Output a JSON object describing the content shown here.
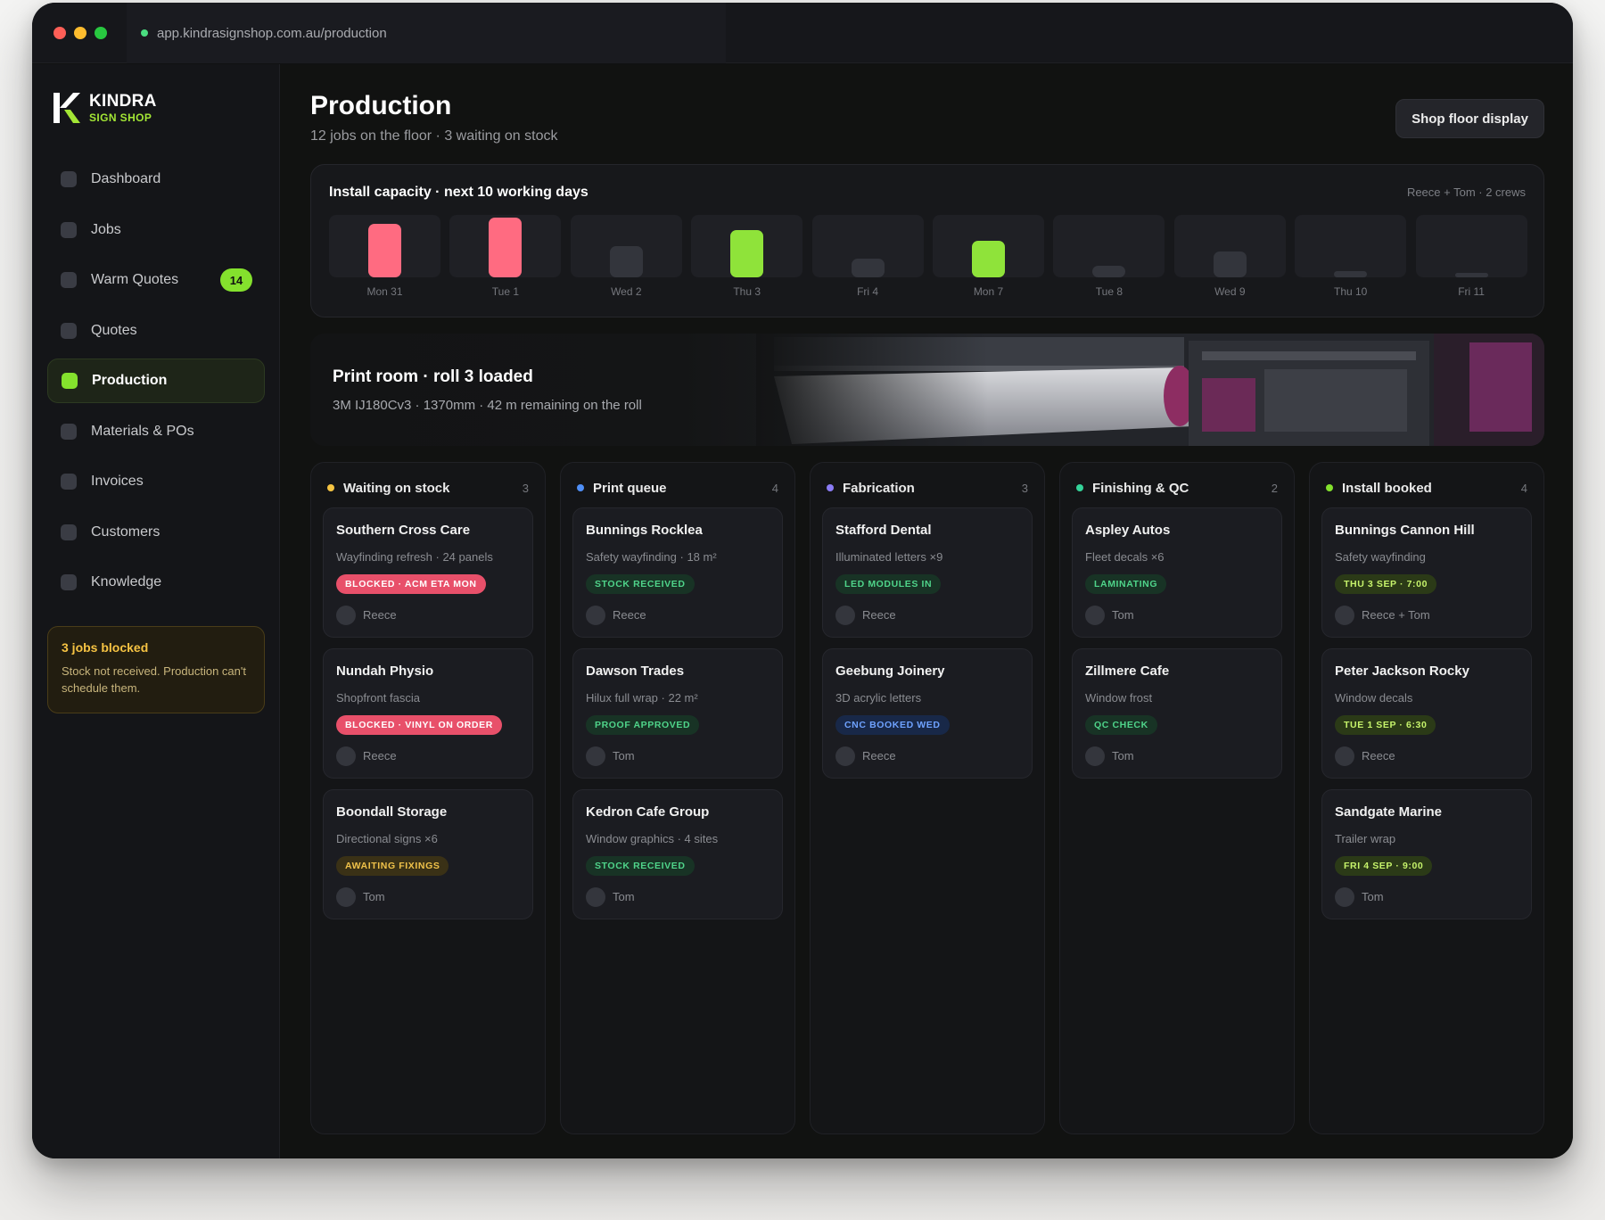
{
  "browser": {
    "url": "app.kindrasignshop.com.au/production",
    "colors": {
      "close": "#ff5f57",
      "minimize": "#febc2e",
      "maximize": "#28c840"
    }
  },
  "brand": {
    "name": "KINDRA",
    "tagline": "SIGN SHOP",
    "accent": "#84e12d"
  },
  "sidebar": {
    "items": [
      {
        "label": "Dashboard",
        "icon": "dashboard-icon"
      },
      {
        "label": "Jobs",
        "icon": "jobs-icon"
      },
      {
        "label": "Warm Quotes",
        "icon": "warm-quotes-icon",
        "badge": "14"
      },
      {
        "label": "Quotes",
        "icon": "quotes-icon"
      },
      {
        "label": "Production",
        "icon": "production-icon",
        "active": true
      },
      {
        "label": "Materials & POs",
        "icon": "materials-icon"
      },
      {
        "label": "Invoices",
        "icon": "invoices-icon"
      },
      {
        "label": "Customers",
        "icon": "customers-icon"
      },
      {
        "label": "Knowledge",
        "icon": "knowledge-icon"
      }
    ],
    "alert": {
      "title": "3 jobs blocked",
      "body": "Stock not received. Production can't schedule them."
    }
  },
  "header": {
    "title": "Production",
    "subtitle": "12 jobs on the floor · 3 waiting on stock",
    "button": "Shop floor display"
  },
  "capacity": {
    "title": "Install capacity · next 10 working days",
    "meta": "Reece + Tom · 2 crews",
    "days": [
      {
        "label": "Mon 31",
        "load": 0.86,
        "status": "over"
      },
      {
        "label": "Tue 1",
        "load": 0.96,
        "status": "over"
      },
      {
        "label": "Wed 2",
        "load": 0.5,
        "status": "free"
      },
      {
        "label": "Thu 3",
        "load": 0.76,
        "status": "booked"
      },
      {
        "label": "Fri 4",
        "load": 0.3,
        "status": "free"
      },
      {
        "label": "Mon 7",
        "load": 0.58,
        "status": "booked"
      },
      {
        "label": "Tue 8",
        "load": 0.18,
        "status": "free"
      },
      {
        "label": "Wed 9",
        "load": 0.42,
        "status": "free"
      },
      {
        "label": "Thu 10",
        "load": 0.1,
        "status": "free"
      },
      {
        "label": "Fri 11",
        "load": 0.06,
        "status": "free"
      }
    ],
    "colors": {
      "over": "#ff6b81",
      "booked": "#8fe33a",
      "free": "#33353c"
    }
  },
  "print_room": {
    "title": "Print room · roll 3 loaded",
    "subtitle": "3M IJ180Cv3 · 1370mm · 42 m remaining on the roll"
  },
  "board": {
    "columns": [
      {
        "title": "Waiting on stock",
        "count": "3",
        "dot": "#f5c442",
        "cards": [
          {
            "title": "Southern Cross Care",
            "sub": "Wayfinding refresh · 24 panels",
            "tag": "BLOCKED · ACM ETA MON",
            "tag_style": "blocked",
            "assignee": "Reece"
          },
          {
            "title": "Nundah Physio",
            "sub": "Shopfront fascia",
            "tag": "BLOCKED · VINYL ON ORDER",
            "tag_style": "blocked",
            "assignee": "Reece"
          },
          {
            "title": "Boondall Storage",
            "sub": "Directional signs ×6",
            "tag": "AWAITING FIXINGS",
            "tag_style": "awaiting",
            "assignee": "Tom"
          }
        ]
      },
      {
        "title": "Print queue",
        "count": "4",
        "dot": "#4f8ff7",
        "cards": [
          {
            "title": "Bunnings Rocklea",
            "sub": "Safety wayfinding · 18 m²",
            "tag": "STOCK RECEIVED",
            "tag_style": "green",
            "assignee": "Reece"
          },
          {
            "title": "Dawson Trades",
            "sub": "Hilux full wrap · 22 m²",
            "tag": "PROOF APPROVED",
            "tag_style": "green",
            "assignee": "Tom"
          },
          {
            "title": "Kedron Cafe Group",
            "sub": "Window graphics · 4 sites",
            "tag": "STOCK RECEIVED",
            "tag_style": "green",
            "assignee": "Tom"
          }
        ]
      },
      {
        "title": "Fabrication",
        "count": "3",
        "dot": "#8b7cf6",
        "cards": [
          {
            "title": "Stafford Dental",
            "sub": "Illuminated letters ×9",
            "tag": "LED MODULES IN",
            "tag_style": "green",
            "assignee": "Reece"
          },
          {
            "title": "Geebung Joinery",
            "sub": "3D acrylic letters",
            "tag": "CNC BOOKED WED",
            "tag_style": "blue",
            "assignee": "Reece"
          }
        ]
      },
      {
        "title": "Finishing & QC",
        "count": "2",
        "dot": "#34d399",
        "cards": [
          {
            "title": "Aspley Autos",
            "sub": "Fleet decals ×6",
            "tag": "LAMINATING",
            "tag_style": "green",
            "assignee": "Tom"
          },
          {
            "title": "Zillmere Cafe",
            "sub": "Window frost",
            "tag": "QC CHECK",
            "tag_style": "green",
            "assignee": "Tom"
          }
        ]
      },
      {
        "title": "Install booked",
        "count": "4",
        "dot": "#84e12d",
        "cards": [
          {
            "title": "Bunnings Cannon Hill",
            "sub": "Safety wayfinding",
            "tag": "THU 3 SEP · 7:00",
            "tag_style": "lime",
            "assignee": "Reece + Tom"
          },
          {
            "title": "Peter Jackson Rocky",
            "sub": "Window decals",
            "tag": "TUE 1 SEP · 6:30",
            "tag_style": "lime",
            "assignee": "Reece"
          },
          {
            "title": "Sandgate Marine",
            "sub": "Trailer wrap",
            "tag": "FRI 4 SEP · 9:00",
            "tag_style": "lime",
            "assignee": "Tom"
          }
        ]
      }
    ],
    "tag_colors": {
      "blocked": {
        "bg": "#e8506a",
        "fg": "#ffffff"
      },
      "awaiting": {
        "bg": "#3a3116",
        "fg": "#f0c24a"
      },
      "green": {
        "bg": "#183325",
        "fg": "#4fd48a"
      },
      "blue": {
        "bg": "#182848",
        "fg": "#6ea2ff"
      },
      "lime": {
        "bg": "#2b3a17",
        "fg": "#c6f36b"
      }
    }
  }
}
